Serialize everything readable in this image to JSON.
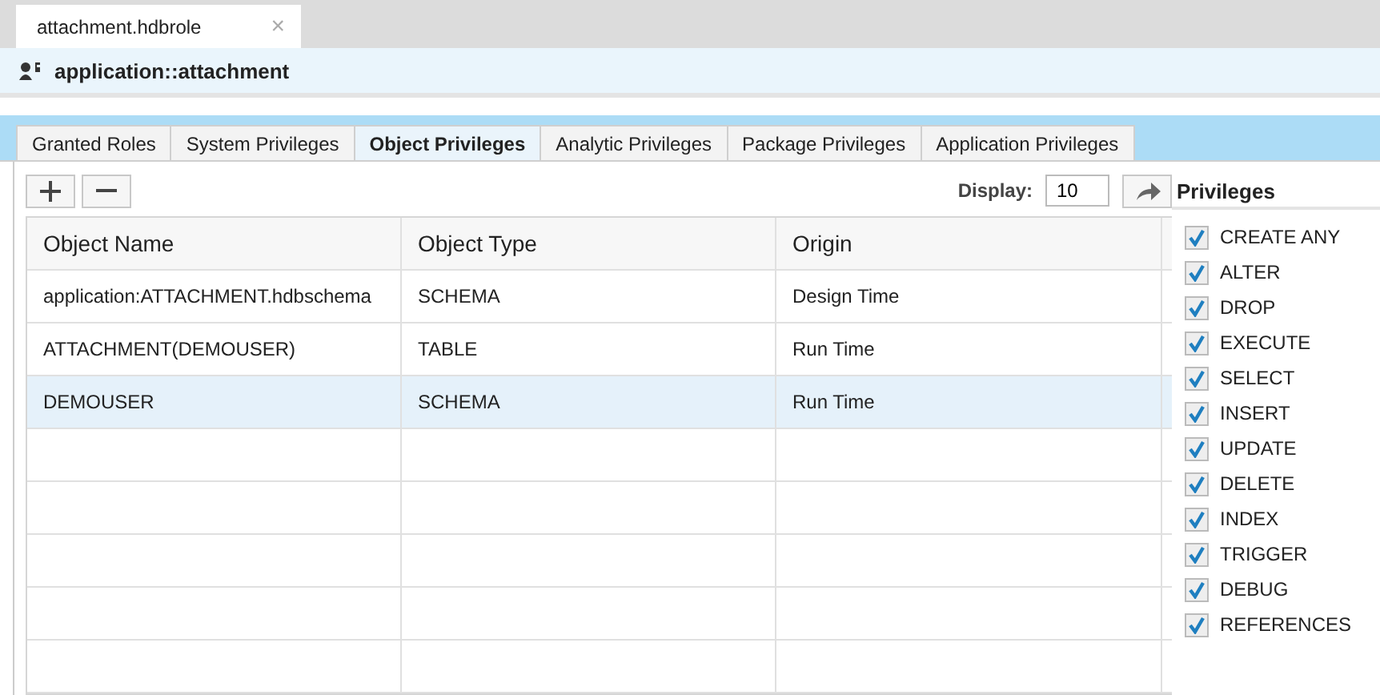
{
  "editor_tab": {
    "label": "attachment.hdbrole",
    "close": "×"
  },
  "header": {
    "title": "application::attachment"
  },
  "tabs": [
    {
      "label": "Granted Roles",
      "selected": false
    },
    {
      "label": "System Privileges",
      "selected": false
    },
    {
      "label": "Object Privileges",
      "selected": true
    },
    {
      "label": "Analytic Privileges",
      "selected": false
    },
    {
      "label": "Package Privileges",
      "selected": false
    },
    {
      "label": "Application Privileges",
      "selected": false
    }
  ],
  "toolbar": {
    "display_label": "Display:",
    "display_value": "10"
  },
  "table": {
    "columns": [
      "Object Name",
      "Object Type",
      "Origin"
    ],
    "rows": [
      {
        "cells": [
          "application:ATTACHMENT.hdbschema",
          "SCHEMA",
          "Design Time"
        ],
        "selected": false
      },
      {
        "cells": [
          "ATTACHMENT(DEMOUSER)",
          "TABLE",
          "Run Time"
        ],
        "selected": false
      },
      {
        "cells": [
          "DEMOUSER",
          "SCHEMA",
          "Run Time"
        ],
        "selected": true
      }
    ]
  },
  "privileges": {
    "title": "Privileges",
    "items": [
      {
        "label": "CREATE ANY",
        "checked": true
      },
      {
        "label": "ALTER",
        "checked": true
      },
      {
        "label": "DROP",
        "checked": true
      },
      {
        "label": "EXECUTE",
        "checked": true
      },
      {
        "label": "SELECT",
        "checked": true
      },
      {
        "label": "INSERT",
        "checked": true
      },
      {
        "label": "UPDATE",
        "checked": true
      },
      {
        "label": "DELETE",
        "checked": true
      },
      {
        "label": "INDEX",
        "checked": true
      },
      {
        "label": "TRIGGER",
        "checked": true
      },
      {
        "label": "DEBUG",
        "checked": true
      },
      {
        "label": "REFERENCES",
        "checked": true
      }
    ]
  }
}
